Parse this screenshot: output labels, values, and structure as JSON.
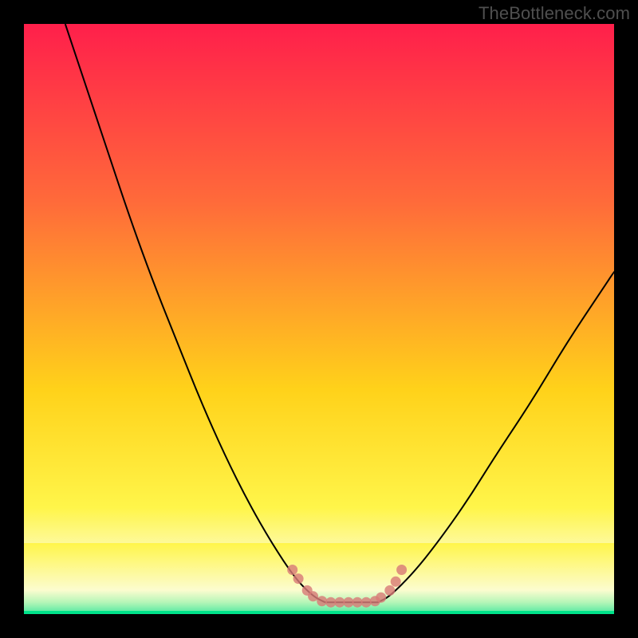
{
  "watermark": "TheBottleneck.com",
  "colors": {
    "black": "#000000",
    "grad_top": "#ff1f4b",
    "grad_upper": "#ff6a3a",
    "grad_mid": "#ffd21a",
    "grad_lower": "#fff54a",
    "pale_yellow": "#fcfccf",
    "green_top": "#b7f6b8",
    "green_mid": "#4be8a0",
    "green_line": "#00e28a",
    "curve": "#000000",
    "marker": "#d87b78"
  },
  "chart_data": {
    "type": "line",
    "title": "",
    "xlabel": "",
    "ylabel": "",
    "xlim": [
      0,
      100
    ],
    "ylim": [
      0,
      100
    ],
    "series": [
      {
        "name": "left-curve",
        "x": [
          7,
          10,
          14,
          18,
          22,
          26,
          30,
          34,
          38,
          42,
          46,
          49,
          51
        ],
        "y": [
          100,
          91,
          79,
          67,
          56,
          46,
          36,
          27,
          19,
          12,
          6,
          3,
          2
        ]
      },
      {
        "name": "right-curve",
        "x": [
          60,
          62,
          66,
          70,
          75,
          80,
          86,
          92,
          98,
          100
        ],
        "y": [
          2,
          3,
          7,
          12,
          19,
          27,
          36,
          46,
          55,
          58
        ]
      },
      {
        "name": "flat-bottom",
        "x": [
          51,
          53,
          55,
          57,
          59,
          60
        ],
        "y": [
          2,
          2,
          2,
          2,
          2,
          2
        ]
      }
    ],
    "markers": {
      "name": "bottom-markers",
      "points": [
        {
          "x": 45.5,
          "y": 7.5
        },
        {
          "x": 46.5,
          "y": 6.0
        },
        {
          "x": 48.0,
          "y": 4.0
        },
        {
          "x": 49.0,
          "y": 3.0
        },
        {
          "x": 50.5,
          "y": 2.2
        },
        {
          "x": 52.0,
          "y": 2.0
        },
        {
          "x": 53.5,
          "y": 2.0
        },
        {
          "x": 55.0,
          "y": 2.0
        },
        {
          "x": 56.5,
          "y": 2.0
        },
        {
          "x": 58.0,
          "y": 2.0
        },
        {
          "x": 59.5,
          "y": 2.2
        },
        {
          "x": 60.5,
          "y": 2.8
        },
        {
          "x": 62.0,
          "y": 4.0
        },
        {
          "x": 63.0,
          "y": 5.5
        },
        {
          "x": 64.0,
          "y": 7.5
        }
      ]
    },
    "bands": {
      "pale_yellow": {
        "from_y": 12,
        "to_y": 4
      },
      "green": {
        "from_y": 4,
        "to_y": 0
      }
    }
  }
}
